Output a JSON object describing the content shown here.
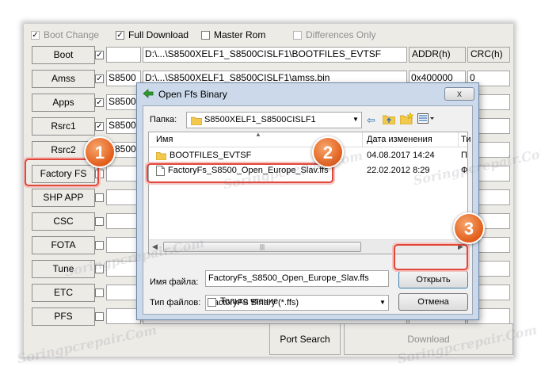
{
  "options": {
    "boot_change": "Boot Change",
    "full_download": "Full Download",
    "master_rom": "Master Rom",
    "differences_only": "Differences Only"
  },
  "rows": [
    {
      "button": "Boot",
      "checked": true,
      "size": "",
      "path": "D:\\...\\S8500XELF1_S8500CISLF1\\BOOTFILES_EVTSF",
      "addr": "ADDR(h)",
      "crc": "CRC(h)"
    },
    {
      "button": "Amss",
      "checked": true,
      "size": "S8500",
      "path": "D:\\...\\S8500XELF1_S8500CISLF1\\amss.bin",
      "addr": "0x400000",
      "crc": "0"
    },
    {
      "button": "Apps",
      "checked": true,
      "size": "S8500",
      "path": "",
      "addr": "",
      "crc": ""
    },
    {
      "button": "Rsrc1",
      "checked": true,
      "size": "S8500",
      "path": "",
      "addr": "",
      "crc": ""
    },
    {
      "button": "Rsrc2",
      "checked": true,
      "size": "S8500",
      "path": "",
      "addr": "",
      "crc": ""
    },
    {
      "button": "Factory FS",
      "checked": false,
      "size": "",
      "path": "",
      "addr": "",
      "crc": ""
    },
    {
      "button": "SHP APP",
      "checked": false,
      "size": "",
      "path": "",
      "addr": "",
      "crc": ""
    },
    {
      "button": "CSC",
      "checked": false,
      "size": "",
      "path": "",
      "addr": "",
      "crc": ""
    },
    {
      "button": "FOTA",
      "checked": false,
      "size": "",
      "path": "",
      "addr": "",
      "crc": ""
    },
    {
      "button": "Tune",
      "checked": false,
      "size": "",
      "path": "",
      "addr": "",
      "crc": ""
    },
    {
      "button": "ETC",
      "checked": false,
      "size": "",
      "path": "",
      "addr": "",
      "crc": ""
    },
    {
      "button": "PFS",
      "checked": false,
      "size": "",
      "path": "",
      "addr": "",
      "crc": ""
    }
  ],
  "bottom": {
    "port_search": "Port Search",
    "download": "Download"
  },
  "dialog": {
    "title": "Open Ffs Binary",
    "folder_label": "Папка:",
    "folder_value": "S8500XELF1_S8500CISLF1",
    "col_name": "Имя",
    "col_date": "Дата изменения",
    "col_type": "Ти",
    "files": [
      {
        "name": "BOOTFILES_EVTSF",
        "date": "04.08.2017 14:24",
        "type": "П"
      },
      {
        "name": "FactoryFs_S8500_Open_Europe_Slav.ffs",
        "date": "22.02.2012 8:29",
        "type": "Ф"
      }
    ],
    "filename_label": "Имя файла:",
    "filename_value": "FactoryFs_S8500_Open_Europe_Slav.ffs",
    "filetype_label": "Тип файлов:",
    "filetype_value": "FactoryFS Binary (*.ffs)",
    "readonly_label": "Только чтение",
    "open_button": "Открыть",
    "cancel_button": "Отмена",
    "close_glyph": "x"
  },
  "badges": {
    "one": "1",
    "two": "2",
    "three": "3"
  },
  "watermark": "Soringpcrepair.Com",
  "colors": {
    "badge": "#e35d1a",
    "highlight": "#e2473c",
    "dialog_frame": "#cbd9ea",
    "selected_row": "#cce8ff"
  }
}
